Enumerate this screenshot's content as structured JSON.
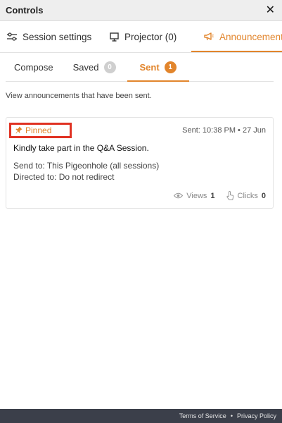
{
  "header": {
    "title": "Controls",
    "close_glyph": "✕"
  },
  "main_tabs": [
    {
      "label": "Session settings",
      "icon": "sliders-icon",
      "active": false
    },
    {
      "label": "Projector (0)",
      "icon": "monitor-icon",
      "active": false
    },
    {
      "label": "Announcement",
      "icon": "megaphone-icon",
      "active": true
    }
  ],
  "sub_tabs": {
    "compose": {
      "label": "Compose"
    },
    "saved": {
      "label": "Saved",
      "count": "0"
    },
    "sent": {
      "label": "Sent",
      "count": "1"
    }
  },
  "description": "View announcements that have been sent.",
  "announcement": {
    "pinned_label": "Pinned",
    "sent_time": "Sent: 10:38 PM • 27 Jun",
    "message": "Kindly take part in the Q&A Session.",
    "send_to": "Send to: This Pigeonhole (all sessions)",
    "directed_to": "Directed to: Do not redirect",
    "views_label": "Views",
    "views_count": "1",
    "clicks_label": "Clicks",
    "clicks_count": "0"
  },
  "footer": {
    "terms": "Terms of Service",
    "separator": "•",
    "privacy": "Privacy Policy"
  },
  "colors": {
    "accent": "#e2852c",
    "highlight_box": "#e03223",
    "footer_bg": "#3b3f4a"
  }
}
